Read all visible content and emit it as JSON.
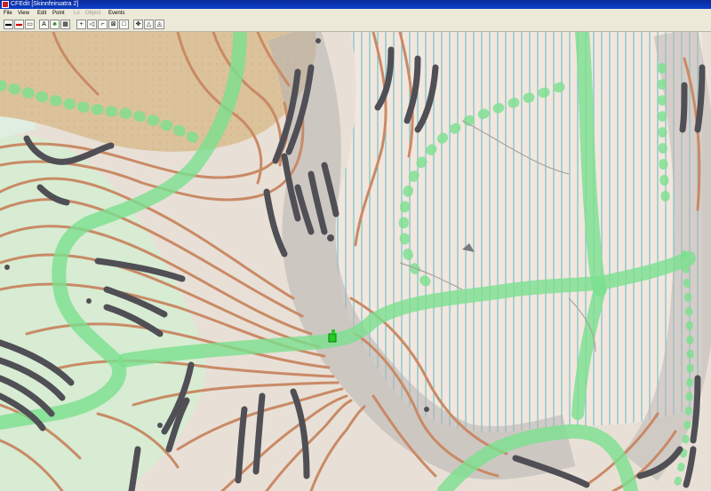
{
  "window": {
    "title": "CFEdit [Skinnfeiruatra 2]"
  },
  "menu": [
    "File",
    "View",
    "Edit",
    "Point",
    "Ln",
    "Object",
    "Events"
  ],
  "menu_disabled": [
    false,
    false,
    false,
    false,
    true,
    true,
    false
  ],
  "toolbar": [
    {
      "name": "save-icon",
      "glyph": "▬"
    },
    {
      "name": "save-red-icon",
      "glyph": "▬"
    },
    {
      "name": "load-icon",
      "glyph": "▭"
    },
    {
      "name": "text-icon",
      "glyph": "A"
    },
    {
      "name": "tree-icon",
      "glyph": "♣"
    },
    {
      "name": "grid-icon",
      "glyph": "▦"
    },
    {
      "name": "point-add-icon",
      "glyph": "+"
    },
    {
      "name": "rotate-left-icon",
      "glyph": "◁"
    },
    {
      "name": "line-tool-icon",
      "glyph": "⌐"
    },
    {
      "name": "zoom-fit-icon",
      "glyph": "⊠"
    },
    {
      "name": "page-icon",
      "glyph": "□"
    },
    {
      "name": "move-icon",
      "glyph": "✥"
    },
    {
      "name": "triangle-icon",
      "glyph": "△"
    },
    {
      "name": "triangle-edit-icon",
      "glyph": "◬"
    }
  ],
  "colors": {
    "ground": "#e8e0d6",
    "contour": "#c98a66",
    "path": "#7be08f",
    "cliff": "#4f4f55",
    "open_field": "#d7bf9a",
    "forest": "#d7ecd2",
    "stripes": "#6ec6c4"
  }
}
